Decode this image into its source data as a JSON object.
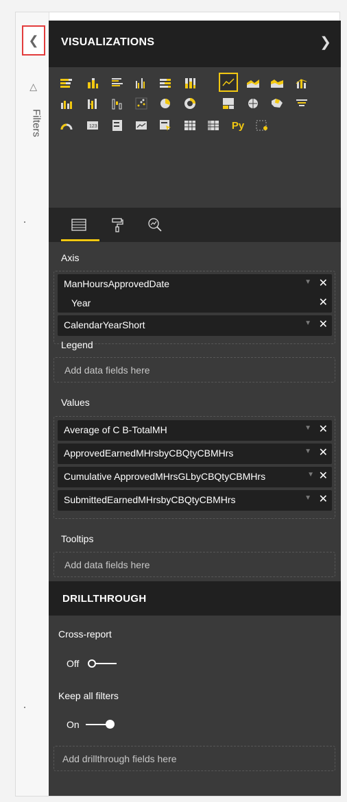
{
  "filters_pane": {
    "collapse_icon": "chevron-left-icon",
    "filter_icon": "funnel-icon",
    "label": "Filters"
  },
  "visualizations": {
    "title": "VISUALIZATIONS",
    "expand_icon": "chevron-right-icon",
    "gallery": [
      [
        "stacked-bar-chart-icon",
        "stacked-column-chart-icon",
        "clustered-bar-chart-icon",
        "clustered-column-chart-icon",
        "100-stacked-bar-chart-icon",
        "100-stacked-column-chart-icon",
        "line-chart-icon",
        "area-chart-icon",
        "stacked-area-chart-icon",
        "line-and-stacked-column-chart-icon"
      ],
      [
        "line-and-clustered-column-chart-icon",
        "ribbon-chart-icon",
        "waterfall-chart-icon",
        "scatter-chart-icon",
        "pie-chart-icon",
        "donut-chart-icon",
        "treemap-icon",
        "map-icon",
        "filled-map-icon",
        "funnel-chart-icon"
      ],
      [
        "gauge-icon",
        "card-icon",
        "multi-row-card-icon",
        "kpi-icon",
        "slicer-icon",
        "table-icon",
        "matrix-icon",
        "python-visual-icon",
        "custom-visual-icon"
      ]
    ],
    "selected_visual": "line-chart-icon",
    "python_label": "Py"
  },
  "pane_tabs": [
    {
      "name": "fields-tab-icon",
      "active": true
    },
    {
      "name": "format-paint-roller-icon",
      "active": false
    },
    {
      "name": "analytics-magnifier-icon",
      "active": false
    }
  ],
  "wells": {
    "axis": {
      "label": "Axis",
      "fields": [
        {
          "name": "ManHoursApprovedDate",
          "sub": "Year"
        },
        {
          "name": "CalendarYearShort"
        }
      ]
    },
    "legend": {
      "label": "Legend",
      "placeholder": "Add data fields here"
    },
    "values": {
      "label": "Values",
      "fields": [
        {
          "name": "Average of C B-TotalMH"
        },
        {
          "name": "ApprovedEarnedMHrsbyCBQtyCBMHrs"
        },
        {
          "name": "Cumulative ApprovedMHrsGLbyCBQtyCBMHrs"
        },
        {
          "name": "SubmittedEarnedMHrsbyCBQtyCBMHrs"
        }
      ]
    },
    "tooltips": {
      "label": "Tooltips",
      "placeholder": "Add data fields here"
    }
  },
  "drillthrough": {
    "title": "DRILLTHROUGH",
    "cross_report": {
      "label": "Cross-report",
      "state": "Off"
    },
    "keep_all_filters": {
      "label": "Keep all filters",
      "state": "On"
    },
    "placeholder": "Add drillthrough fields here"
  },
  "colors": {
    "accent": "#f2c811",
    "panel_bg": "#3a3a3a",
    "header_bg": "#202020",
    "highlight_border": "#e23b3b"
  }
}
